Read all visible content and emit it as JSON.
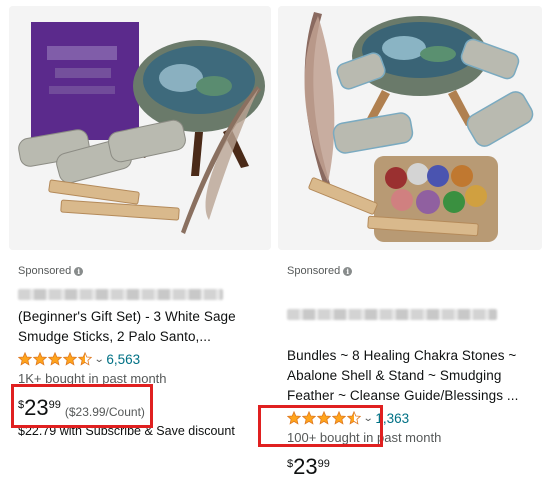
{
  "cards": [
    {
      "sponsored": "Sponsored",
      "title": "(Beginner's Gift Set) - 3 White Sage\nSmudge Sticks, 2 Palo Santo,...",
      "rating_value": 4.5,
      "rating_count": "6,563",
      "bought": "1K+ bought in past month",
      "price": {
        "currency": "$",
        "whole": "23",
        "fraction": "99"
      },
      "unit_price": "($23.99/Count)",
      "subscribe": "$22.79 with Subscribe & Save discount"
    },
    {
      "sponsored": "Sponsored",
      "title": "Bundles ~ 8 Healing Chakra Stones ~\nAbalone Shell & Stand ~ Smudging\nFeather ~ Cleanse Guide/Blessings ...",
      "rating_value": 4.5,
      "rating_count": "1,363",
      "bought": "100+ bought in past month",
      "price": {
        "currency": "$",
        "whole": "23",
        "fraction": "99"
      }
    }
  ],
  "colors": {
    "star": "#ffa41c",
    "link": "#007185",
    "highlight": "#e02020"
  },
  "icons": [
    "info-icon",
    "star-icon",
    "chevron-down-icon"
  ]
}
